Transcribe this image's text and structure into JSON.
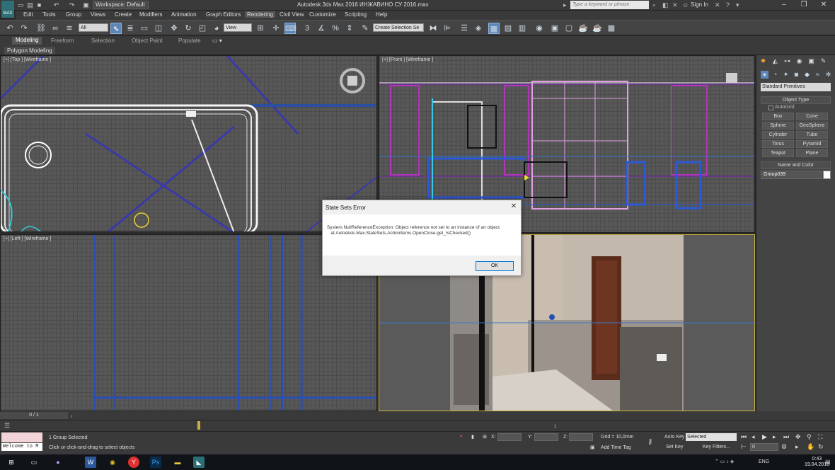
{
  "window": {
    "logo": "MAX",
    "workspace": "Workspace: Default",
    "title": "Autodesk 3ds Max 2016    ИНЖАВИНО СУ 2016.max",
    "search_placeholder": "Type a keyword or phrase",
    "sign_in": "Sign In"
  },
  "menu": [
    "Edit",
    "Tools",
    "Group",
    "Views",
    "Create",
    "Modifiers",
    "Animation",
    "Graph Editors",
    "Rendering",
    "Civil View",
    "Customize",
    "Scripting",
    "Help"
  ],
  "toolbar": {
    "selection_filter": "All",
    "ref_coord": "View",
    "named_selection": "Create Selection Se"
  },
  "ribbon": {
    "tabs": [
      "Modeling",
      "Freeform",
      "Selection",
      "Object Paint",
      "Populate"
    ],
    "active_tab": "Modeling",
    "panel": "Polygon Modeling"
  },
  "viewports": {
    "top_label": "[+] [Top ] [Wireframe ]",
    "front_label": "[+] [Front ] [Wireframe ]",
    "left_label": "[+] [Left ] [Wireframe ]"
  },
  "command_panel": {
    "primitive_type": "Standard Primitives",
    "object_type_header": "Object Type",
    "autogrid": "AutoGrid",
    "buttons": [
      "Box",
      "Cone",
      "Sphere",
      "GeoSphere",
      "Cylinder",
      "Tube",
      "Torus",
      "Pyramid",
      "Teapot",
      "Plane"
    ],
    "name_color_header": "Name and Color",
    "object_name": "Group039",
    "object_color": "#ffffff"
  },
  "dialog": {
    "title": "State Sets Error",
    "message": "System.NullReferenceException: Object reference not set to an instance of an object.\n   at Autodesk.Max.StateSets.ActionItems.OpenClose.get_IsChecked()",
    "ok": "OK"
  },
  "timeline": {
    "frame": "0 / 1",
    "marker": "1"
  },
  "status": {
    "maxscript": "Welcome to M",
    "selected": "1 Group Selected",
    "prompt": "Click or click-and-drag to select objects",
    "x_label": "X:",
    "y_label": "Y:",
    "z_label": "Z:",
    "grid": "Grid = 10,0mm",
    "add_time_tag": "Add Time Tag",
    "auto_key": "Auto Key",
    "key_mode": "Selected",
    "set_key": "Set Key",
    "key_filters": "Key Filters...",
    "current_frame": "0"
  },
  "taskbar": {
    "lang": "ENG",
    "time": "0:43",
    "date": "19.04.2018"
  }
}
